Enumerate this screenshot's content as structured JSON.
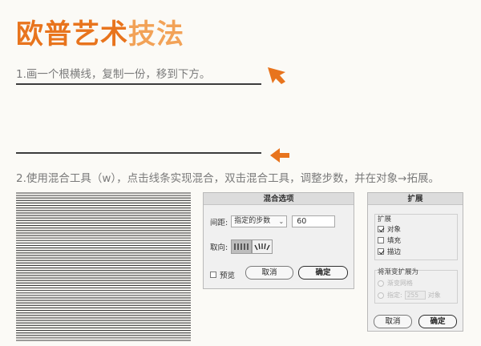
{
  "title": {
    "part1": "欧普艺术",
    "part2": "技法"
  },
  "steps": {
    "step1": "1.画一个根横线，复制一份，移到下方。",
    "step2": "2.使用混合工具（w），点击线条实现混合，双击混合工具，调整步数，并在对象→拓展。"
  },
  "colors": {
    "accent": "#e8741d",
    "accent_light": "#f2a257",
    "line": "#3c3c3c"
  },
  "icons": {
    "arrow": "arrow-left-icon"
  },
  "blend_preview": {
    "line_count": 60
  },
  "blend_dialog": {
    "title": "混合选项",
    "spacing_label": "间距:",
    "spacing_value": "指定的步数",
    "steps_value": "60",
    "orientation_label": "取向:",
    "preview_label": "预览",
    "preview_checked": false,
    "cancel_label": "取消",
    "ok_label": "确定"
  },
  "expand_dialog": {
    "title": "扩展",
    "group_expand_label": "扩展",
    "options": [
      {
        "label": "对象",
        "checked": true
      },
      {
        "label": "填充",
        "checked": false
      },
      {
        "label": "描边",
        "checked": true
      }
    ],
    "group_gradient_label": "将渐变扩展为",
    "gradient_mesh_label": "渐变网格",
    "specify_label": "指定:",
    "specify_value": "255",
    "specify_unit": "对象",
    "cancel_label": "取消",
    "ok_label": "确定"
  }
}
